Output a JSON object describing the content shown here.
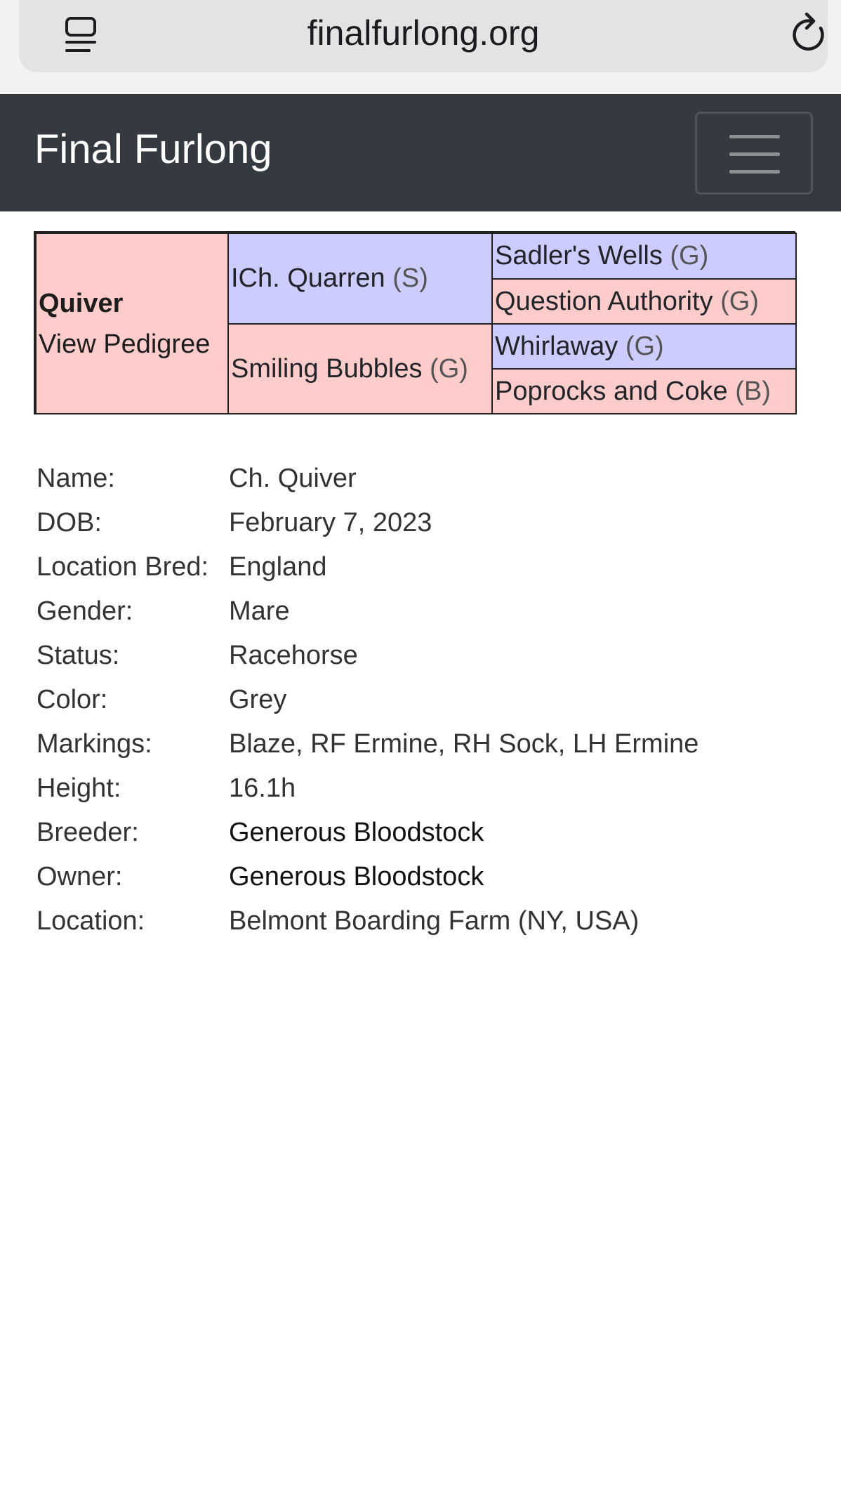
{
  "browser": {
    "url": "finalfurlong.org",
    "reader_icon": "reader-mode-icon",
    "reload_icon": "reload-icon"
  },
  "navbar": {
    "brand": "Final Furlong",
    "toggler_icon": "hamburger-menu-icon"
  },
  "pedigree": {
    "horse": {
      "name": "Quiver",
      "link": "View Pedigree"
    },
    "sire": {
      "name": "ICh. Quarren",
      "tag": "(S)"
    },
    "dam": {
      "name": "Smiling Bubbles",
      "tag": "(G)"
    },
    "sire_sire": {
      "name": "Sadler's Wells",
      "tag": "(G)"
    },
    "sire_dam": {
      "name": "Question Authority",
      "tag": "(G)"
    },
    "dam_sire": {
      "name": "Whirlaway",
      "tag": "(G)"
    },
    "dam_dam": {
      "name": "Poprocks and Coke",
      "tag": "(B)"
    },
    "colors": {
      "male": "#ccccff",
      "female": "#ffcccc"
    }
  },
  "details": [
    {
      "label": "Name:",
      "value": "Ch. Quiver"
    },
    {
      "label": "DOB:",
      "value": "February 7, 2023"
    },
    {
      "label": "Location Bred:",
      "value": "England"
    },
    {
      "label": "Gender:",
      "value": "Mare"
    },
    {
      "label": "Status:",
      "value": "Racehorse"
    },
    {
      "label": "Color:",
      "value": "Grey"
    },
    {
      "label": "Markings:",
      "value": "Blaze, RF Ermine, RH Sock, LH Ermine"
    },
    {
      "label": "Height:",
      "value": "16.1h"
    },
    {
      "label": "Breeder:",
      "value": "Generous Bloodstock"
    },
    {
      "label": "Owner:",
      "value": "Generous Bloodstock"
    },
    {
      "label": "Location:",
      "value": "Belmont Boarding Farm (NY, USA)"
    }
  ]
}
